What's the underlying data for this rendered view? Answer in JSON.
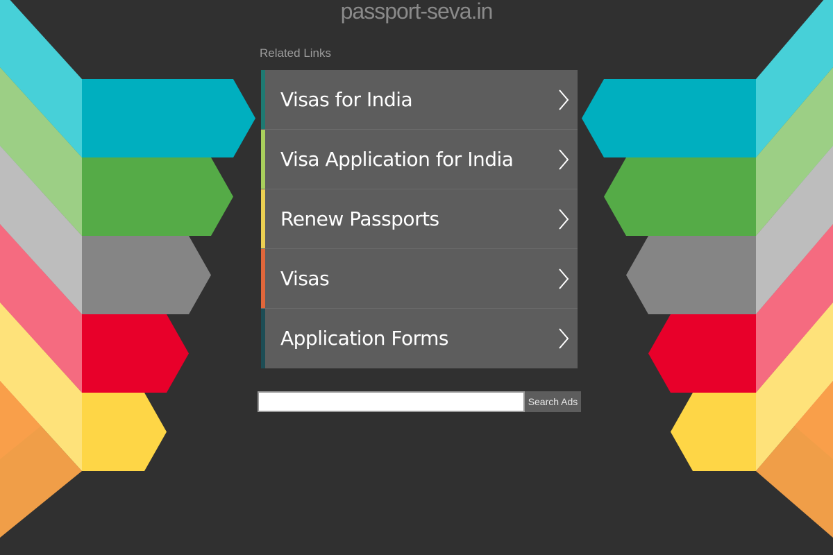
{
  "site": {
    "title": "passport-seva.in"
  },
  "related": {
    "heading": "Related Links",
    "links": [
      {
        "label": "Visas for India",
        "accent": "#1e7a72"
      },
      {
        "label": "Visa Application for India",
        "accent": "#a9cf5c"
      },
      {
        "label": "Renew Passports",
        "accent": "#ecd052"
      },
      {
        "label": "Visas",
        "accent": "#e0663a"
      },
      {
        "label": "Application Forms",
        "accent": "#1d4d55"
      }
    ],
    "chevron_icon": "chevron-right-icon"
  },
  "search": {
    "placeholder": "",
    "value": "",
    "button_label": "Search Ads"
  },
  "theme": {
    "background": "#303030",
    "row_background": "#5d5d5d",
    "bands": [
      "#00afbf",
      "#55ab47",
      "#858585",
      "#e8002a",
      "#fed646"
    ],
    "bands_light": [
      "#47d0d8",
      "#9ccf85",
      "#bdbdbd",
      "#f56b80",
      "#fee27a"
    ],
    "bands_mid": [
      "#11bca7",
      "#84ad6d",
      "#9f9f9f",
      "#d94a5e",
      "#fba44a"
    ]
  }
}
